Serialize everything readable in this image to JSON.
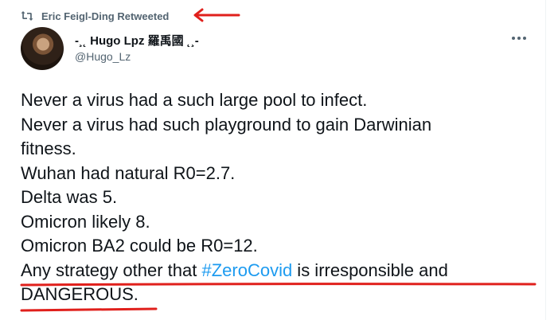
{
  "tweet": {
    "retweet_label": "Eric Feigl-Ding Retweeted",
    "author": {
      "name": "-¸˛ Hugo Lpz 羅禹國 ˛¸-",
      "handle": "@Hugo_Lz"
    },
    "lines": [
      "Never a virus had a such large pool to infect.",
      "Never a virus had such playground to gain Darwinian",
      "fitness.",
      "Wuhan had natural R0=2.7.",
      "Delta was 5.",
      "Omicron likely 8.",
      "Omicron BA2 could be R0=12."
    ],
    "last_line_before": "Any strategy other that ",
    "hashtag": "#ZeroCovid",
    "last_line_after": " is irresponsible and",
    "final_line": "DANGEROUS."
  },
  "colors": {
    "text": "#0f1419",
    "secondary": "#536471",
    "link": "#1d9bf0",
    "annotation": "#e0201c"
  },
  "icons": {
    "retweet": "retweet-icon",
    "more": "more-options-icon",
    "annotation_arrow": "red-arrow-annotation"
  }
}
